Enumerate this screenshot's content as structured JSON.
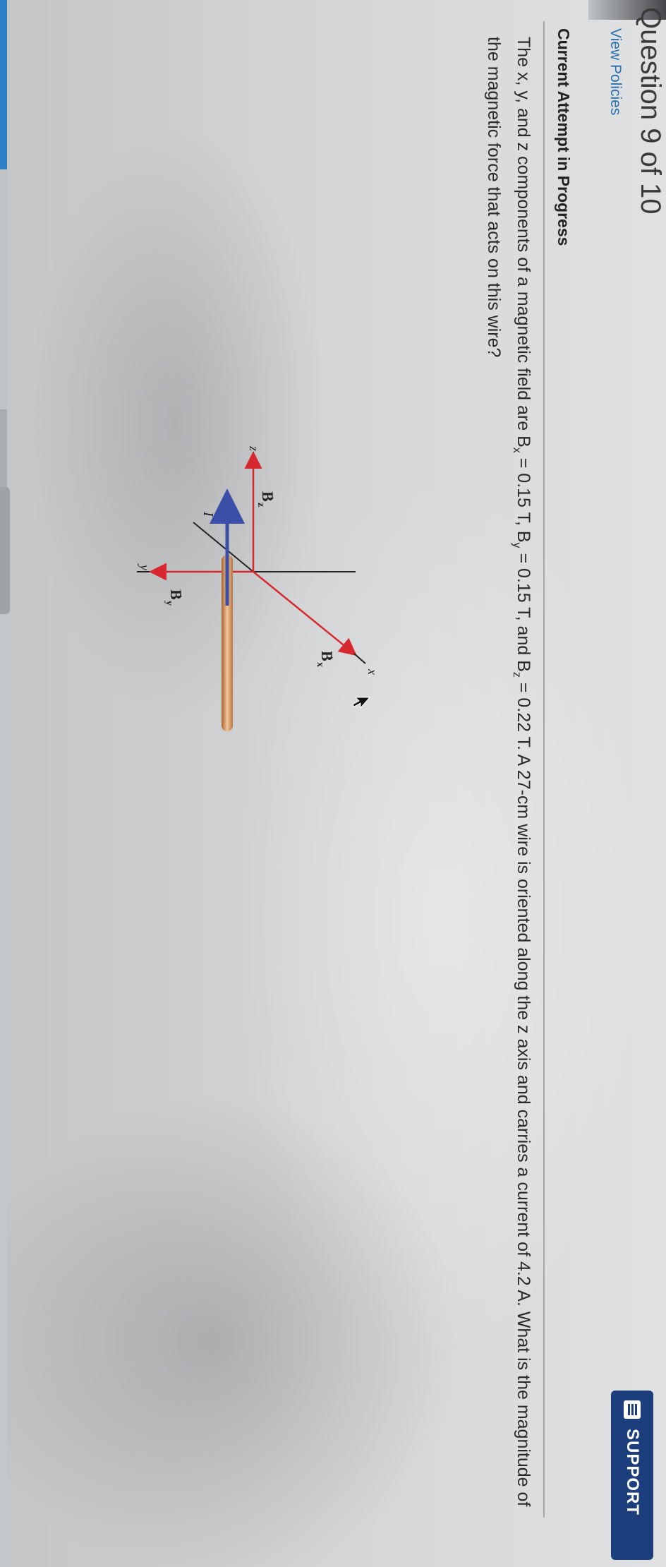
{
  "header": {
    "partial_title": "Question 9 of 10"
  },
  "links": {
    "view_policies": "View Policies"
  },
  "attempt": {
    "title": "Current Attempt in Progress"
  },
  "question": {
    "text_a": "The x, y, and z components of a magnetic field are B",
    "sub_x": "x",
    "text_b": " = 0.15 T, B",
    "sub_y": "y",
    "text_c": " = 0.15 T, and B",
    "sub_z": "z",
    "text_d": " = 0.22 T. A 27-cm wire is oriented along the z axis and carries a current of 4.2 A. What is the magnitude of the magnetic force that acts on this wire?"
  },
  "figure": {
    "axis_x": "x",
    "axis_y": "y",
    "axis_z": "z",
    "current_label": "I",
    "bx_label": "B",
    "bx_sub": "x",
    "by_label": "B",
    "by_sub": "y",
    "bz_label": "B",
    "bz_sub": "z",
    "colors": {
      "field_arrow": "#d8282f",
      "wire": "#d79a66",
      "current_arrow": "#3b4fa8"
    }
  },
  "support": {
    "label": "SUPPORT",
    "icon": "document-list-icon"
  }
}
